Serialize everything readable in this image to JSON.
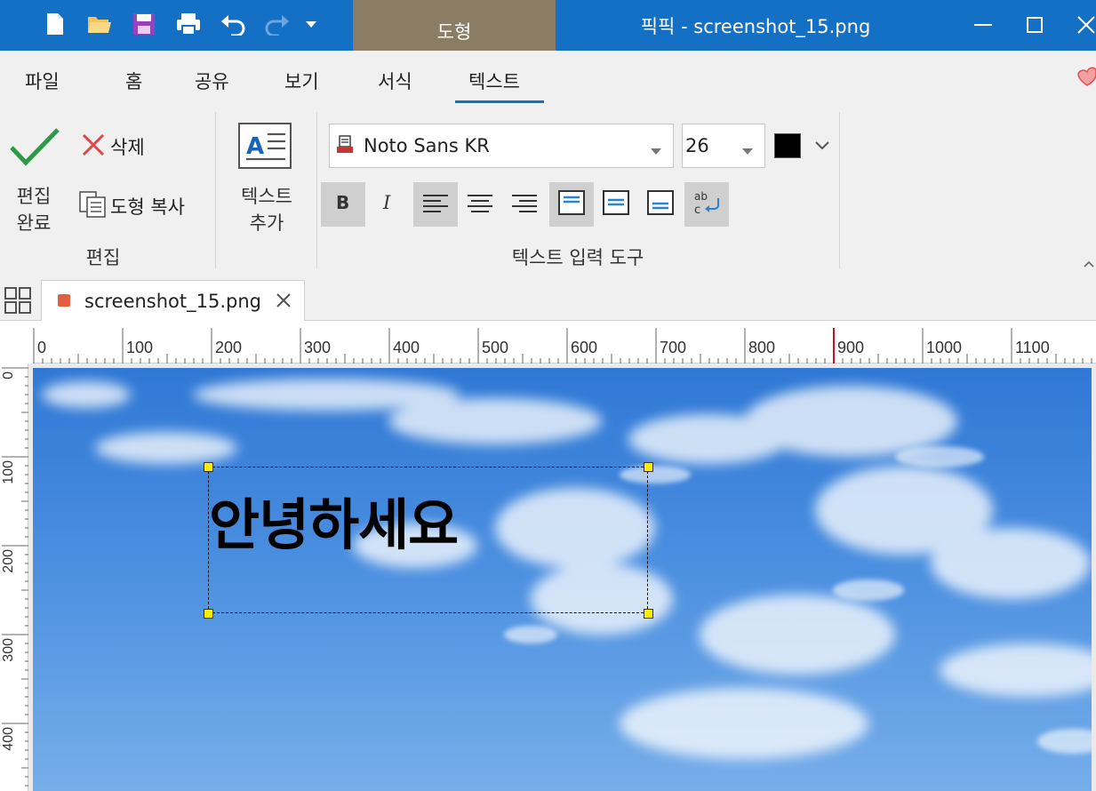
{
  "window": {
    "context_tab": "도형",
    "title": "픽픽 - screenshot_15.png"
  },
  "menu": {
    "tabs": [
      "파일",
      "홈",
      "공유",
      "보기",
      "서식",
      "텍스트"
    ],
    "active": "텍스트"
  },
  "ribbon": {
    "edit_done": [
      "편집",
      "완료"
    ],
    "delete": "삭제",
    "copy_shape": "도형 복사",
    "edit_group": "편집",
    "add_text": [
      "텍스트",
      "추가"
    ],
    "font_name": "Noto Sans KR",
    "font_size": "26",
    "text_color": "#000000",
    "text_tools_group": "텍스트 입력 도구",
    "active_formats": [
      "bold",
      "align-left",
      "valign-top",
      "word-wrap"
    ]
  },
  "document": {
    "tab_name": "screenshot_15.png"
  },
  "rulers": {
    "horizontal": [
      "0",
      "100",
      "200",
      "300",
      "400",
      "500",
      "600",
      "700",
      "800",
      "900",
      "1000",
      "1100"
    ],
    "vertical": [
      "0",
      "100",
      "200",
      "300",
      "400"
    ]
  },
  "canvas": {
    "text": "안녕하세요"
  },
  "colors": {
    "titlebar": "#1470c4",
    "context_tab": "#8b7c66",
    "handle": "#ffee00",
    "ruler_marker": "#c8102e"
  }
}
